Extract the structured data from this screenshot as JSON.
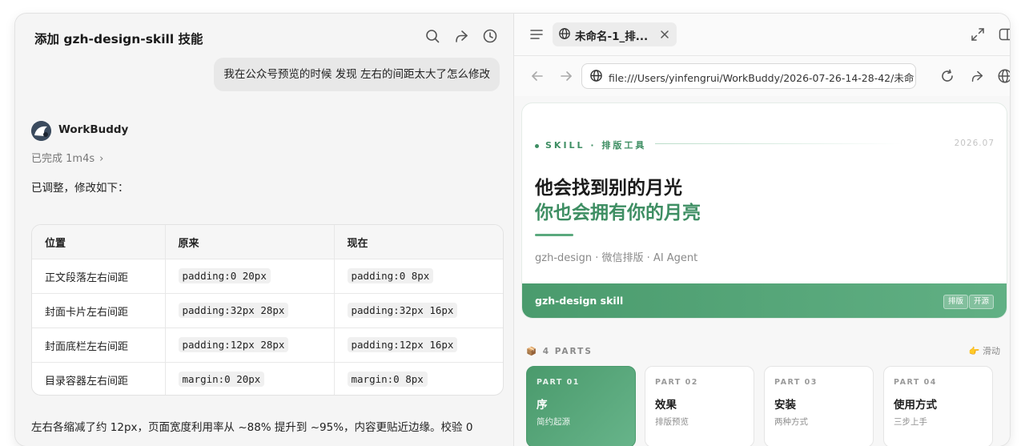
{
  "chat": {
    "title": "添加 gzh-design-skill 技能",
    "user_message": "我在公众号预览的时候 发现 左右的间距太大了怎么修改",
    "agent_name": "WorkBuddy",
    "status": "已完成 1m4s",
    "intro": "已调整，修改如下：",
    "table": {
      "headers": [
        "位置",
        "原来",
        "现在"
      ],
      "rows": [
        [
          "正文段落左右间距",
          "padding:0 20px",
          "padding:0 8px"
        ],
        [
          "封面卡片左右间距",
          "padding:32px 28px",
          "padding:32px 16px"
        ],
        [
          "封面底栏左右间距",
          "padding:12px 28px",
          "padding:12px 16px"
        ],
        [
          "目录容器左右间距",
          "margin:0 20px",
          "margin:0 8px"
        ]
      ]
    },
    "summary": "左右各缩减了约 12px，页面宽度利用率从 ~88% 提升到 ~95%，内容更贴近边缘。校验 0"
  },
  "browser": {
    "tab_title": "未命名-1_排...",
    "url": "file:///Users/yinfengrui/WorkBuddy/2026-07-26-14-28-42/未命",
    "page": {
      "skill_label": "SKILL · 排版工具",
      "date": "2026.07",
      "headline1": "他会找到别的月光",
      "headline2": "你也会拥有你的月亮",
      "subtitle": "gzh-design · 微信排版 · AI Agent",
      "footer_title": "gzh-design skill",
      "footer_tags": [
        "排版",
        "开源"
      ],
      "parts_label": "4 PARTS",
      "swipe_hint": "👉 滑动",
      "parts": [
        {
          "kicker": "PART 01",
          "title": "序",
          "sub": "简约起源"
        },
        {
          "kicker": "PART 02",
          "title": "效果",
          "sub": "排版预览"
        },
        {
          "kicker": "PART 03",
          "title": "安装",
          "sub": "两种方式"
        },
        {
          "kicker": "PART 04",
          "title": "使用方式",
          "sub": "三步上手"
        }
      ]
    }
  },
  "colors": {
    "accent_green": "#3e8e63",
    "footer_green": "#4a9b6d"
  },
  "icons": [
    "search-icon",
    "share-icon",
    "history-icon",
    "menu-icon",
    "globe-icon",
    "close-icon",
    "expand-icon",
    "panel-icon",
    "back-icon",
    "forward-icon",
    "reload-icon",
    "package-icon"
  ]
}
